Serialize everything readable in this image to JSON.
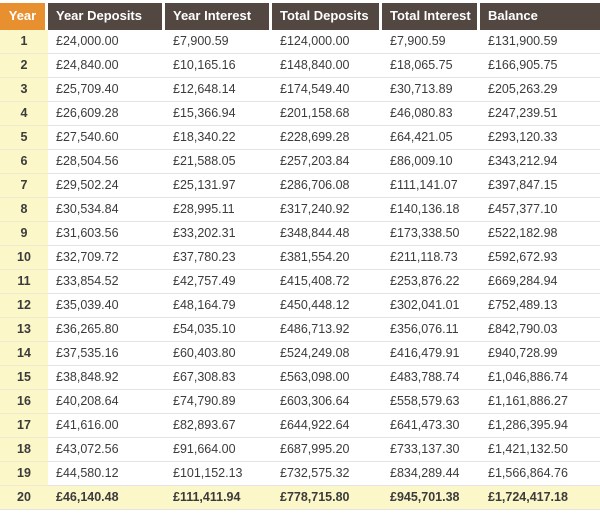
{
  "table": {
    "columns": [
      {
        "key": "year",
        "label": "Year"
      },
      {
        "key": "year_deposits",
        "label": "Year Deposits"
      },
      {
        "key": "year_interest",
        "label": "Year Interest"
      },
      {
        "key": "total_deposits",
        "label": "Total Deposits"
      },
      {
        "key": "total_interest",
        "label": "Total Interest"
      },
      {
        "key": "balance",
        "label": "Balance"
      }
    ],
    "colors": {
      "year_header_background": "#e8902f",
      "header_background": "#534741",
      "header_text": "#ffffff",
      "year_cell_background": "#fbf7c9",
      "total_row_background": "#fbf7c9",
      "row_separator": "#e4e4e4",
      "body_text": "#3b3b3b"
    },
    "rows": [
      {
        "year": "1",
        "year_deposits": "£24,000.00",
        "year_interest": "£7,900.59",
        "total_deposits": "£124,000.00",
        "total_interest": "£7,900.59",
        "balance": "£131,900.59",
        "total": false
      },
      {
        "year": "2",
        "year_deposits": "£24,840.00",
        "year_interest": "£10,165.16",
        "total_deposits": "£148,840.00",
        "total_interest": "£18,065.75",
        "balance": "£166,905.75",
        "total": false
      },
      {
        "year": "3",
        "year_deposits": "£25,709.40",
        "year_interest": "£12,648.14",
        "total_deposits": "£174,549.40",
        "total_interest": "£30,713.89",
        "balance": "£205,263.29",
        "total": false
      },
      {
        "year": "4",
        "year_deposits": "£26,609.28",
        "year_interest": "£15,366.94",
        "total_deposits": "£201,158.68",
        "total_interest": "£46,080.83",
        "balance": "£247,239.51",
        "total": false
      },
      {
        "year": "5",
        "year_deposits": "£27,540.60",
        "year_interest": "£18,340.22",
        "total_deposits": "£228,699.28",
        "total_interest": "£64,421.05",
        "balance": "£293,120.33",
        "total": false
      },
      {
        "year": "6",
        "year_deposits": "£28,504.56",
        "year_interest": "£21,588.05",
        "total_deposits": "£257,203.84",
        "total_interest": "£86,009.10",
        "balance": "£343,212.94",
        "total": false
      },
      {
        "year": "7",
        "year_deposits": "£29,502.24",
        "year_interest": "£25,131.97",
        "total_deposits": "£286,706.08",
        "total_interest": "£111,141.07",
        "balance": "£397,847.15",
        "total": false
      },
      {
        "year": "8",
        "year_deposits": "£30,534.84",
        "year_interest": "£28,995.11",
        "total_deposits": "£317,240.92",
        "total_interest": "£140,136.18",
        "balance": "£457,377.10",
        "total": false
      },
      {
        "year": "9",
        "year_deposits": "£31,603.56",
        "year_interest": "£33,202.31",
        "total_deposits": "£348,844.48",
        "total_interest": "£173,338.50",
        "balance": "£522,182.98",
        "total": false
      },
      {
        "year": "10",
        "year_deposits": "£32,709.72",
        "year_interest": "£37,780.23",
        "total_deposits": "£381,554.20",
        "total_interest": "£211,118.73",
        "balance": "£592,672.93",
        "total": false
      },
      {
        "year": "11",
        "year_deposits": "£33,854.52",
        "year_interest": "£42,757.49",
        "total_deposits": "£415,408.72",
        "total_interest": "£253,876.22",
        "balance": "£669,284.94",
        "total": false
      },
      {
        "year": "12",
        "year_deposits": "£35,039.40",
        "year_interest": "£48,164.79",
        "total_deposits": "£450,448.12",
        "total_interest": "£302,041.01",
        "balance": "£752,489.13",
        "total": false
      },
      {
        "year": "13",
        "year_deposits": "£36,265.80",
        "year_interest": "£54,035.10",
        "total_deposits": "£486,713.92",
        "total_interest": "£356,076.11",
        "balance": "£842,790.03",
        "total": false
      },
      {
        "year": "14",
        "year_deposits": "£37,535.16",
        "year_interest": "£60,403.80",
        "total_deposits": "£524,249.08",
        "total_interest": "£416,479.91",
        "balance": "£940,728.99",
        "total": false
      },
      {
        "year": "15",
        "year_deposits": "£38,848.92",
        "year_interest": "£67,308.83",
        "total_deposits": "£563,098.00",
        "total_interest": "£483,788.74",
        "balance": "£1,046,886.74",
        "total": false
      },
      {
        "year": "16",
        "year_deposits": "£40,208.64",
        "year_interest": "£74,790.89",
        "total_deposits": "£603,306.64",
        "total_interest": "£558,579.63",
        "balance": "£1,161,886.27",
        "total": false
      },
      {
        "year": "17",
        "year_deposits": "£41,616.00",
        "year_interest": "£82,893.67",
        "total_deposits": "£644,922.64",
        "total_interest": "£641,473.30",
        "balance": "£1,286,395.94",
        "total": false
      },
      {
        "year": "18",
        "year_deposits": "£43,072.56",
        "year_interest": "£91,664.00",
        "total_deposits": "£687,995.20",
        "total_interest": "£733,137.30",
        "balance": "£1,421,132.50",
        "total": false
      },
      {
        "year": "19",
        "year_deposits": "£44,580.12",
        "year_interest": "£101,152.13",
        "total_deposits": "£732,575.32",
        "total_interest": "£834,289.44",
        "balance": "£1,566,864.76",
        "total": false
      },
      {
        "year": "20",
        "year_deposits": "£46,140.48",
        "year_interest": "£111,411.94",
        "total_deposits": "£778,715.80",
        "total_interest": "£945,701.38",
        "balance": "£1,724,417.18",
        "total": true
      }
    ]
  }
}
